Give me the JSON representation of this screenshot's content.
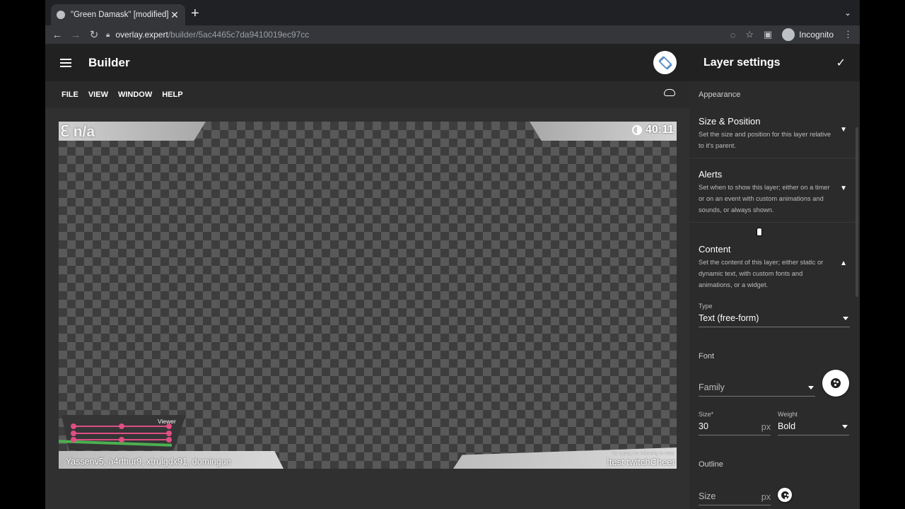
{
  "browser": {
    "tab_title": "\"Green Damask\" [modified] - B",
    "url_host": "overlay.expert",
    "url_path": "/builder/5ac4465c7da9410019ec97cc",
    "profile_label": "Incognito"
  },
  "app": {
    "title": "Builder",
    "menu": [
      "FILE",
      "VIEW",
      "WINDOW",
      "HELP"
    ]
  },
  "canvas": {
    "top_left_text": "ℇ n/a",
    "timer": "40:11",
    "viewer_label": "Viewer",
    "bottom_left_text": ": Yassenv5, a4rthur9, xtrulgdx91, domingue",
    "bottom_right_hint": "Try typing the following in chat:",
    "bottom_right_text": "!test twitchCheer"
  },
  "panel": {
    "title": "Layer settings",
    "section_appearance": "Appearance",
    "size_position": {
      "title": "Size & Position",
      "desc": "Set the size and position for this layer relative to it's parent."
    },
    "alerts": {
      "title": "Alerts",
      "desc": "Set when to show this layer; either on a timer or on an event with custom animations and sounds, or always shown."
    },
    "content": {
      "title": "Content",
      "desc": "Set the content of this layer; either static or dynamic text, with custom fonts and animations, or a widget."
    },
    "type_label": "Type",
    "type_value": "Text (free-form)",
    "font_label": "Font",
    "family_placeholder": "Family",
    "size_label": "Size*",
    "size_value": "30",
    "size_unit": "px",
    "weight_label": "Weight",
    "weight_value": "Bold",
    "outline_label": "Outline",
    "outline_size_placeholder": "Size",
    "outline_unit": "px"
  }
}
